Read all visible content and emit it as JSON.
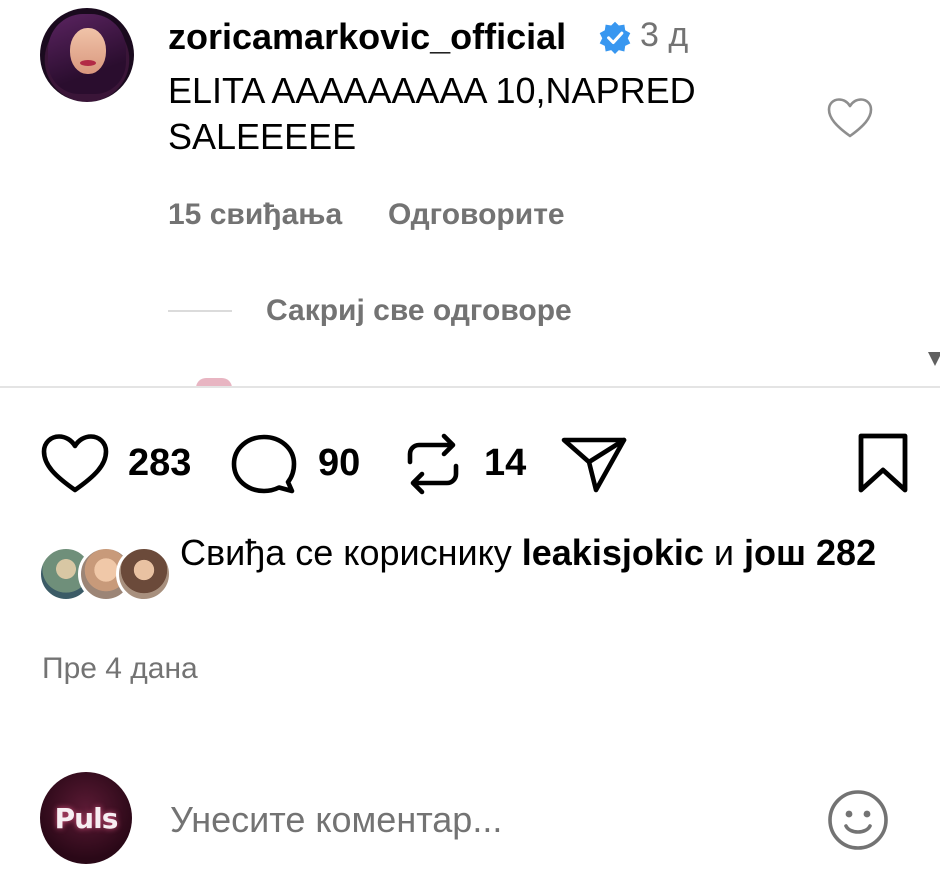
{
  "comment": {
    "username": "zoricamarkovic_official",
    "verified_icon": "verified-badge-icon",
    "time_ago": "3 д",
    "text": "ELITA AAAAAAAAA 10,NAPRED SALEEEEE",
    "likes_label": "15 свиђања",
    "reply_label": "Одговорите",
    "hide_replies_label": "Сакриј све одговоре"
  },
  "actions": {
    "like_count": "283",
    "comment_count": "90",
    "repost_count": "14"
  },
  "liked_by": {
    "prefix": "Свиђа се кориснику ",
    "user": "leakisjokic",
    "connector": " и ",
    "others": "још 282"
  },
  "post_date": "Пре 4 дана",
  "input": {
    "avatar_text": "Puls",
    "placeholder": "Унесите коментар..."
  },
  "colors": {
    "verified_blue": "#3897f0",
    "secondary_text": "#737373"
  }
}
